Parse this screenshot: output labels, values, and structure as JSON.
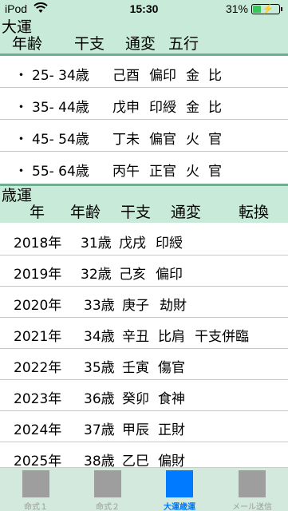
{
  "status_bar": {
    "carrier": "iPod",
    "time": "15:30",
    "battery_percent": "31%",
    "battery_level": 0.31
  },
  "taiun": {
    "title": "大運",
    "columns": [
      "年齢",
      "干支",
      "通変",
      "五行"
    ],
    "rows": [
      {
        "bullet": "・",
        "age": "25- 34歳",
        "kanshi": "己酉",
        "tsuhen": "偏印",
        "element": "金",
        "relation": "比"
      },
      {
        "bullet": "・",
        "age": "35- 44歳",
        "kanshi": "戊申",
        "tsuhen": "印綬",
        "element": "金",
        "relation": "比"
      },
      {
        "bullet": "・",
        "age": "45- 54歳",
        "kanshi": "丁未",
        "tsuhen": "偏官",
        "element": "火",
        "relation": "官"
      },
      {
        "bullet": "・",
        "age": "55- 64歳",
        "kanshi": "丙午",
        "tsuhen": "正官",
        "element": "火",
        "relation": "官"
      }
    ]
  },
  "saiun": {
    "title": "歳運",
    "columns": [
      "年",
      "年齢",
      "干支",
      "通変",
      "転換"
    ],
    "rows": [
      {
        "year": "2018年",
        "age": "31歳",
        "kanshi": "戊戌",
        "tsuhen": "印綬",
        "tenkan": ""
      },
      {
        "year": "2019年",
        "age": "32歳",
        "kanshi": "己亥",
        "tsuhen": "偏印",
        "tenkan": ""
      },
      {
        "year": "2020年",
        "age": "33歳",
        "kanshi": "庚子",
        "tsuhen": "劫財",
        "tenkan": ""
      },
      {
        "year": "2021年",
        "age": "34歳",
        "kanshi": "辛丑",
        "tsuhen": "比肩",
        "tenkan": "干支併臨"
      },
      {
        "year": "2022年",
        "age": "35歳",
        "kanshi": "壬寅",
        "tsuhen": "傷官",
        "tenkan": ""
      },
      {
        "year": "2023年",
        "age": "36歳",
        "kanshi": "癸卯",
        "tsuhen": "食神",
        "tenkan": ""
      },
      {
        "year": "2024年",
        "age": "37歳",
        "kanshi": "甲辰",
        "tsuhen": "正財",
        "tenkan": ""
      },
      {
        "year": "2025年",
        "age": "38歳",
        "kanshi": "乙巳",
        "tsuhen": "偏財",
        "tenkan": ""
      }
    ]
  },
  "tabbar": {
    "active": "大運歳運",
    "tabs": [
      {
        "label": "命式１",
        "icon": "tab-placeholder-icon"
      },
      {
        "label": "命式２",
        "icon": "tab-placeholder-icon"
      },
      {
        "label": "大運歳運",
        "icon": "tab-placeholder-icon"
      },
      {
        "label": "メール送信",
        "icon": "tab-placeholder-icon"
      }
    ]
  },
  "colors": {
    "header_bg": "#c8ead8",
    "header_rule": "#6fae91",
    "tab_active": "#007aff",
    "tab_inactive": "#9b9b9b",
    "battery": "#38c759"
  }
}
